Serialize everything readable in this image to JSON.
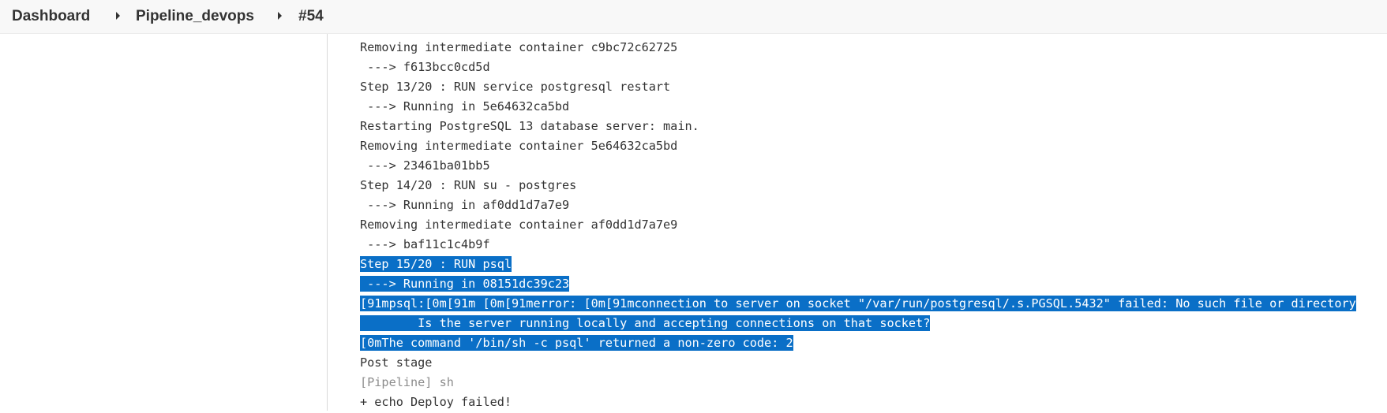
{
  "breadcrumb": {
    "items": [
      "Dashboard",
      "Pipeline_devops",
      "#54"
    ]
  },
  "console": {
    "lines": [
      {
        "text": "Removing intermediate container c9bc72c62725",
        "selected": false,
        "dim": false
      },
      {
        "text": " ---> f613bcc0cd5d",
        "selected": false,
        "dim": false
      },
      {
        "text": "Step 13/20 : RUN service postgresql restart",
        "selected": false,
        "dim": false
      },
      {
        "text": " ---> Running in 5e64632ca5bd",
        "selected": false,
        "dim": false
      },
      {
        "text": "Restarting PostgreSQL 13 database server: main.",
        "selected": false,
        "dim": false
      },
      {
        "text": "Removing intermediate container 5e64632ca5bd",
        "selected": false,
        "dim": false
      },
      {
        "text": " ---> 23461ba01bb5",
        "selected": false,
        "dim": false
      },
      {
        "text": "Step 14/20 : RUN su - postgres",
        "selected": false,
        "dim": false
      },
      {
        "text": " ---> Running in af0dd1d7a7e9",
        "selected": false,
        "dim": false
      },
      {
        "text": "Removing intermediate container af0dd1d7a7e9",
        "selected": false,
        "dim": false
      },
      {
        "text": " ---> baf11c1c4b9f",
        "selected": false,
        "dim": false
      },
      {
        "text": "Step 15/20 : RUN psql",
        "selected": true,
        "dim": false
      },
      {
        "text": " ---> Running in 08151dc39c23",
        "selected": true,
        "dim": false
      },
      {
        "text": "[91mpsql:[0m[91m [0m[91merror: [0m[91mconnection to server on socket \"/var/run/postgresql/.s.PGSQL.5432\" failed: No such file or directory",
        "selected": true,
        "dim": false
      },
      {
        "text": "        Is the server running locally and accepting connections on that socket?",
        "selected": true,
        "dim": false
      },
      {
        "text": "[0mThe command '/bin/sh -c psql' returned a non-zero code: 2",
        "selected": true,
        "dim": false
      },
      {
        "text": "Post stage",
        "selected": false,
        "dim": false
      },
      {
        "text": "[Pipeline] sh",
        "selected": false,
        "dim": true
      },
      {
        "text": "+ echo Deploy failed!",
        "selected": false,
        "dim": false
      }
    ]
  },
  "colors": {
    "selection_bg": "#0a6fc7",
    "selection_fg": "#ffffff",
    "text": "#333333",
    "dim_text": "#8c8c8c"
  }
}
